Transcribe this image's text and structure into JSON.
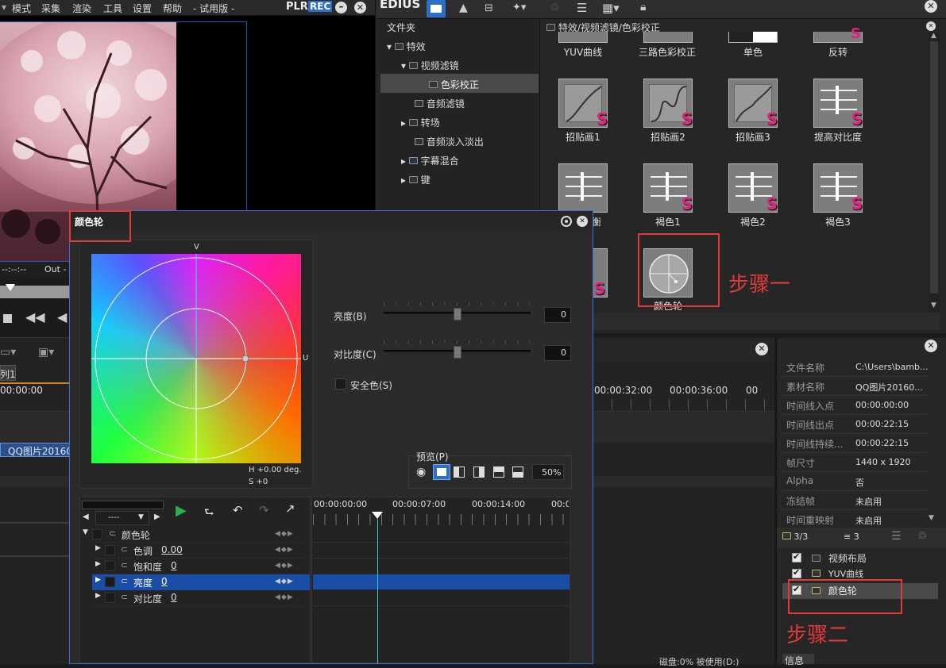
{
  "top_menu": {
    "items": [
      "模式",
      "采集",
      "渲染",
      "工具",
      "设置",
      "帮助"
    ],
    "trial": "- 试用版 -",
    "plr": "PLR",
    "rec": "REC"
  },
  "preview": {
    "timecode_left": "--:--:--",
    "out_label": "Out -"
  },
  "edius": {
    "logo": "EDIUS",
    "folder_header": "文件夹",
    "path": "特效/视频滤镜/色彩校正",
    "tree": [
      {
        "label": "特效"
      },
      {
        "label": "视频滤镜"
      },
      {
        "label": "色彩校正"
      },
      {
        "label": "音频滤镜"
      },
      {
        "label": "转场"
      },
      {
        "label": "音频淡入淡出"
      },
      {
        "label": "字幕混合"
      },
      {
        "label": "键"
      }
    ],
    "effects": {
      "row0": [
        "YUV曲线",
        "三路色彩校正",
        "单色",
        "反转"
      ],
      "row1": [
        "招贴画1",
        "招贴画2",
        "招贴画3",
        "提高对比度"
      ],
      "row2": [
        "衡",
        "褐色1",
        "褐色2",
        "褐色3"
      ],
      "selected": "颜色轮"
    }
  },
  "color_wheel": {
    "title": "颜色轮",
    "v_label": "V",
    "u_label": "U",
    "h_readout": "H  +0.00 deg.",
    "s_readout": "S   +0",
    "brightness_label": "亮度(B)",
    "brightness_value": "0",
    "contrast_label": "对比度(C)",
    "contrast_value": "0",
    "safe_color": "安全色(S)",
    "preview_label": "预览(P)",
    "zoom": "50%",
    "dropdown": "----",
    "timeline_ticks": [
      "00:00:00:00",
      "00:00:07:00",
      "00:00:14:00",
      "00:0"
    ],
    "params": [
      {
        "name": "颜色轮",
        "value": ""
      },
      {
        "name": "色调",
        "value": "0.00"
      },
      {
        "name": "饱和度",
        "value": "0"
      },
      {
        "name": "亮度",
        "value": "0"
      },
      {
        "name": "对比度",
        "value": "0"
      }
    ]
  },
  "timeline": {
    "tab": "列1",
    "tc_left": "00:00:00",
    "clip": "QQ图片20160",
    "tc_right": [
      "00:00:32:00",
      "00:00:36:00",
      "00"
    ],
    "status": "磁盘:0% 被使用(D:)"
  },
  "info_panel": {
    "rows": [
      {
        "k": "文件名称",
        "v": "C:\\Users\\bamb..."
      },
      {
        "k": "素材名称",
        "v": "QQ图片20160..."
      },
      {
        "k": "时间线入点",
        "v": "00:00:00:00"
      },
      {
        "k": "时间线出点",
        "v": "00:00:22:15"
      },
      {
        "k": "时间线持续...",
        "v": "00:00:22:15"
      },
      {
        "k": "帧尺寸",
        "v": "1440 x 1920"
      },
      {
        "k": "Alpha",
        "v": "否"
      },
      {
        "k": "冻结帧",
        "v": "未启用"
      },
      {
        "k": "时间重映射",
        "v": "未启用"
      }
    ],
    "count_a": "3/3",
    "count_b": "3",
    "layers": [
      "视频布局",
      "YUV曲线",
      "颜色轮"
    ],
    "footer": "信息"
  },
  "annotations": {
    "step1": "步骤一",
    "step2": "步骤二"
  }
}
